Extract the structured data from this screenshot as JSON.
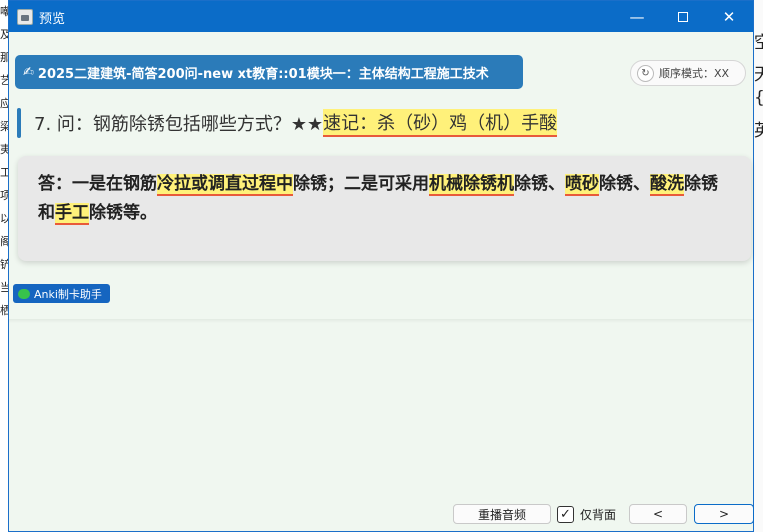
{
  "window": {
    "title": "预览"
  },
  "deck": {
    "icon": "pencil-hand-icon",
    "name": "2025二建建筑-简答200问-new xt教育::01模块一：主体结构工程施工技术"
  },
  "order_mode": {
    "icon": "refresh-icon",
    "label": "顺序模式：XX"
  },
  "question": {
    "text": "7. 问：钢筋除锈包括哪些方式？★★",
    "mnemonic": "速记：杀（砂）鸡（机）手酸"
  },
  "answer": {
    "parts": [
      {
        "text": "答：一是在钢筋",
        "hl": false
      },
      {
        "text": "冷拉或调直过程中",
        "hl": true
      },
      {
        "text": "除锈；二是可采用",
        "hl": false
      },
      {
        "text": "机械除锈机",
        "hl": true
      },
      {
        "text": "除锈、",
        "hl": false
      },
      {
        "text": "喷砂",
        "hl": true
      },
      {
        "text": "除锈、",
        "hl": false
      },
      {
        "text": "酸洗",
        "hl": true
      },
      {
        "text": "除锈和",
        "hl": false
      },
      {
        "text": "手工",
        "hl": true
      },
      {
        "text": "除锈等。",
        "hl": false
      }
    ]
  },
  "badge": {
    "icon": "wechat-icon",
    "label": "Anki制卡助手"
  },
  "controls": {
    "replay_label": "重播音频",
    "back_only_label": "仅背面",
    "back_only_checked": true,
    "prev_label": "<",
    "next_label": ">"
  },
  "background": {
    "left_chars": [
      "嘲",
      "及",
      "那",
      "艺",
      "应",
      "梁",
      "夷",
      "工",
      "项",
      "以",
      "阁",
      "铲",
      "当",
      "栖"
    ],
    "right_chars": [
      "空",
      "天",
      "{",
      "英"
    ]
  },
  "colors": {
    "titlebar": "#0b6cc8",
    "deck_tag": "#2b7bb9",
    "highlight": "#fff17a",
    "underline": "#e85a3a"
  }
}
